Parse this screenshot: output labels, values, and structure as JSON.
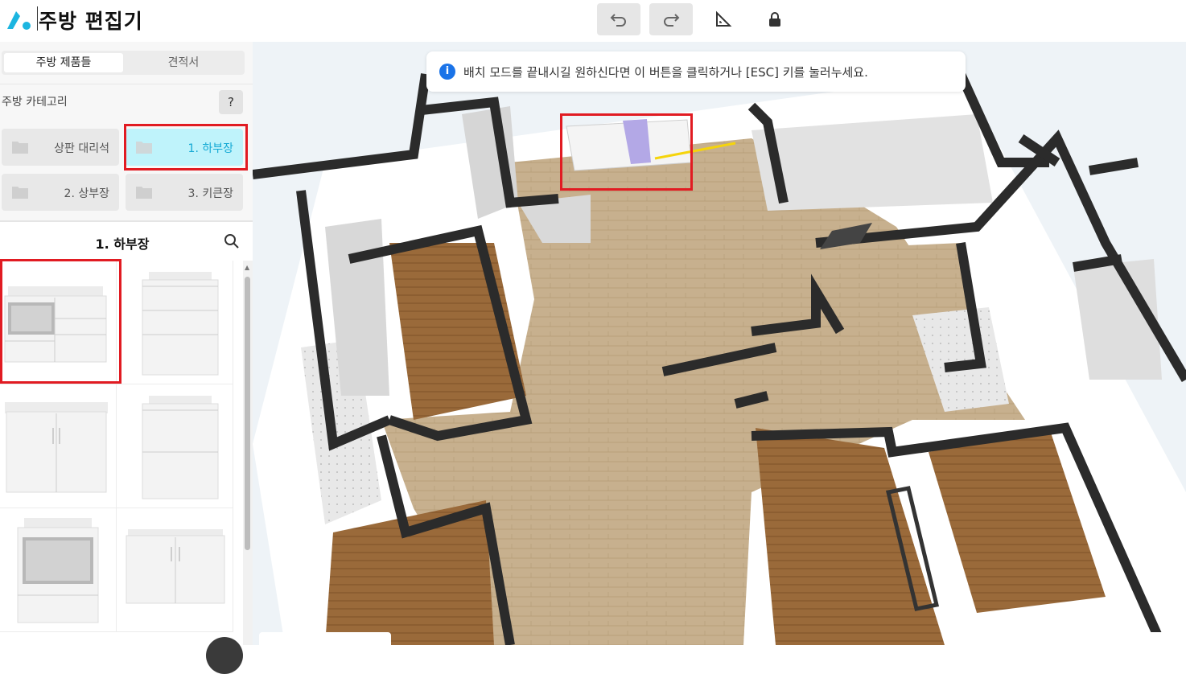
{
  "header": {
    "title": "주방 편집기",
    "undo_icon": "undo-icon",
    "redo_icon": "redo-icon",
    "ruler_icon": "ruler-icon",
    "lock_icon": "lock-icon"
  },
  "sidebar": {
    "tabs": [
      {
        "label": "주방 제품들",
        "active": true
      },
      {
        "label": "견적서",
        "active": false
      }
    ],
    "category_label": "주방 카테고리",
    "help_label": "?",
    "categories": [
      {
        "label": "상판 대리석",
        "selected": false
      },
      {
        "label": "1. 하부장",
        "selected": true
      },
      {
        "label": "2. 상부장",
        "selected": false
      },
      {
        "label": "3. 키큰장",
        "selected": false
      }
    ],
    "list_title": "1. 하부장",
    "products_count_visible": 6
  },
  "canvas": {
    "notice": "배치 모드를 끝내시길 원하신다면 이 버튼을 클릭하거나 [ESC] 키를 눌러누세요."
  },
  "colors": {
    "accent": "#15a9d4",
    "selected_bg": "#bff3fb",
    "highlight": "#e11b22",
    "info": "#1a73e8"
  }
}
